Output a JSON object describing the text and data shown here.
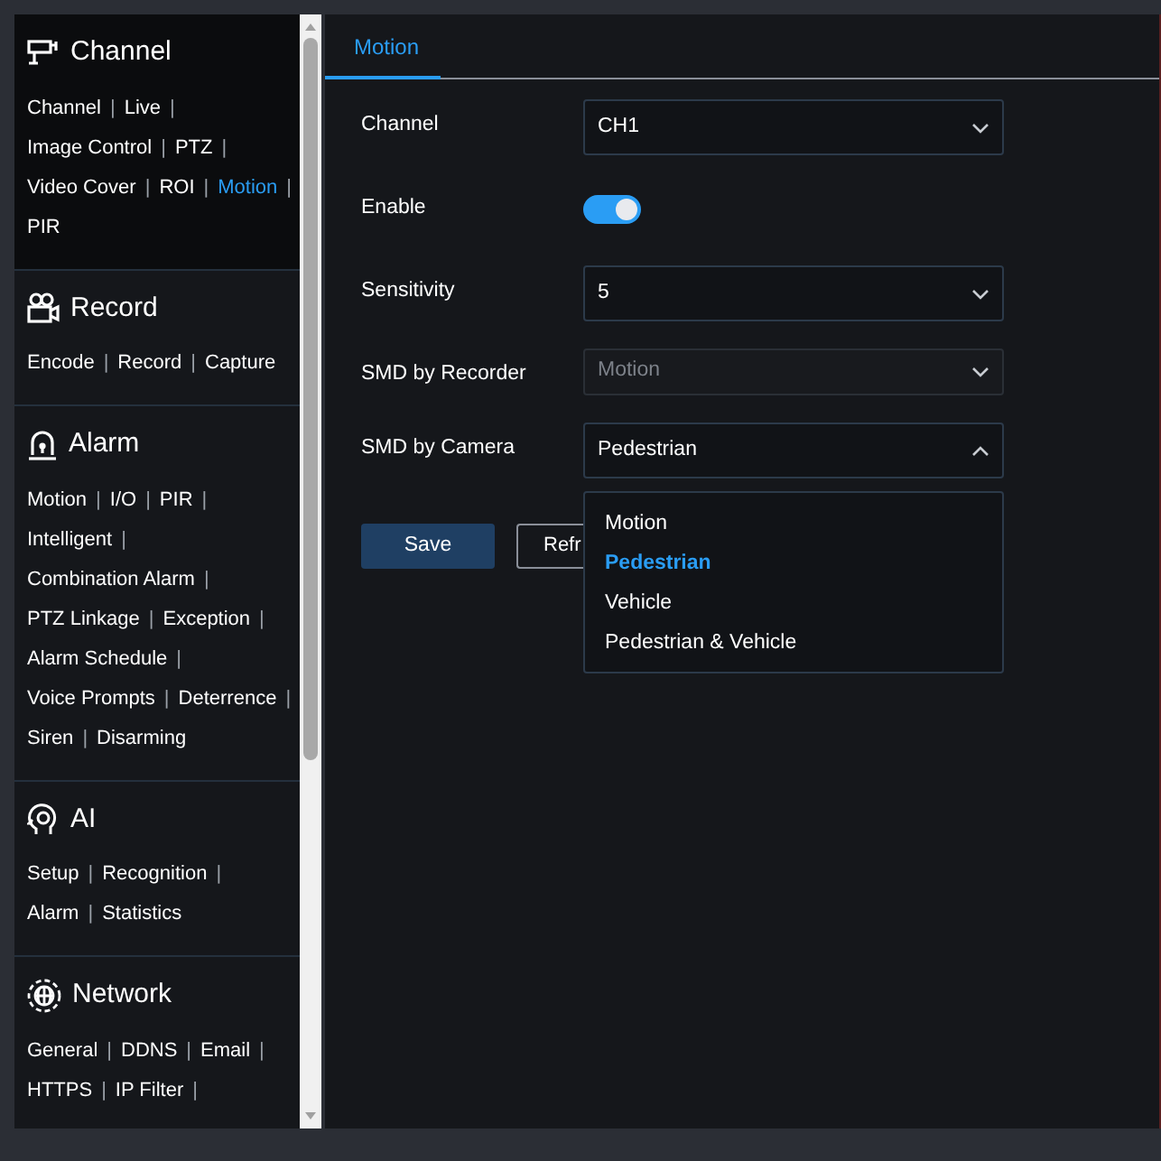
{
  "sidebar": {
    "sections": [
      {
        "kind": "channel",
        "title": "Channel",
        "rows": [
          [
            {
              "label": "Channel",
              "separator": "|",
              "selected": false
            },
            {
              "label": "Live",
              "separator": "|",
              "selected": false
            }
          ],
          [
            {
              "label": "Image Control",
              "separator": "|",
              "selected": false
            },
            {
              "label": "PTZ",
              "separator": "|",
              "selected": false
            }
          ],
          [
            {
              "label": "Video Cover",
              "separator": "|",
              "selected": false
            },
            {
              "label": "ROI",
              "separator": "|",
              "selected": false
            },
            {
              "label": "Motion",
              "separator": "|",
              "selected": true
            }
          ],
          [
            {
              "label": "PIR",
              "selected": false
            }
          ]
        ]
      },
      {
        "kind": "record",
        "title": "Record",
        "rows": [
          [
            {
              "label": "Encode",
              "separator": "|",
              "selected": false
            },
            {
              "label": "Record",
              "separator": "|",
              "selected": false
            },
            {
              "label": "Capture",
              "selected": false
            }
          ]
        ]
      },
      {
        "kind": "alarm",
        "title": "Alarm",
        "rows": [
          [
            {
              "label": "Motion",
              "separator": "|",
              "selected": false
            },
            {
              "label": "I/O",
              "separator": "|",
              "selected": false
            },
            {
              "label": "PIR",
              "separator": "|",
              "selected": false
            }
          ],
          [
            {
              "label": "Intelligent",
              "separator": "|",
              "selected": false
            }
          ],
          [
            {
              "label": "Combination Alarm",
              "separator": "|",
              "selected": false
            }
          ],
          [
            {
              "label": "PTZ Linkage",
              "separator": "|",
              "selected": false
            },
            {
              "label": "Exception",
              "separator": "|",
              "selected": false
            }
          ],
          [
            {
              "label": "Alarm Schedule",
              "separator": "|",
              "selected": false
            }
          ],
          [
            {
              "label": "Voice Prompts",
              "separator": "|",
              "selected": false
            },
            {
              "label": "Deterrence",
              "separator": "|",
              "selected": false
            }
          ],
          [
            {
              "label": "Siren",
              "separator": "|",
              "selected": false
            },
            {
              "label": "Disarming",
              "selected": false
            }
          ]
        ]
      },
      {
        "kind": "ai",
        "title": "AI",
        "rows": [
          [
            {
              "label": "Setup",
              "separator": "|",
              "selected": false
            },
            {
              "label": "Recognition",
              "separator": "|",
              "selected": false
            }
          ],
          [
            {
              "label": "Alarm",
              "separator": "|",
              "selected": false
            },
            {
              "label": "Statistics",
              "selected": false
            }
          ]
        ]
      },
      {
        "kind": "network",
        "title": "Network",
        "rows": [
          [
            {
              "label": "General",
              "separator": "|",
              "selected": false
            },
            {
              "label": "DDNS",
              "separator": "|",
              "selected": false
            },
            {
              "label": "Email",
              "separator": "|",
              "selected": false
            }
          ],
          [
            {
              "label": "HTTPS",
              "separator": "|",
              "selected": false
            },
            {
              "label": "IP Filter",
              "separator": "|",
              "selected": false
            }
          ]
        ]
      }
    ]
  },
  "tabs": [
    {
      "label": "Motion",
      "selected": true
    }
  ],
  "form": [
    {
      "kind": "select",
      "label": "Channel",
      "value": "CH1",
      "disabled": false,
      "expanded": false
    },
    {
      "kind": "toggle",
      "label": "Enable",
      "on": true
    },
    {
      "kind": "select",
      "label": "Sensitivity",
      "value": "5",
      "disabled": false,
      "expanded": false
    },
    {
      "kind": "select",
      "label": "SMD by Recorder",
      "value": "Motion",
      "disabled": true,
      "expanded": false
    },
    {
      "kind": "select",
      "label": "SMD by Camera",
      "value": "Pedestrian",
      "disabled": false,
      "expanded": true,
      "options": [
        {
          "label": "Motion",
          "selected": false
        },
        {
          "label": "Pedestrian",
          "selected": true
        },
        {
          "label": "Vehicle",
          "selected": false
        },
        {
          "label": "Pedestrian & Vehicle",
          "selected": false
        }
      ]
    }
  ],
  "buttons": [
    {
      "kind": "primary",
      "label": "Save"
    },
    {
      "kind": "secondary",
      "label": "Refr"
    }
  ]
}
